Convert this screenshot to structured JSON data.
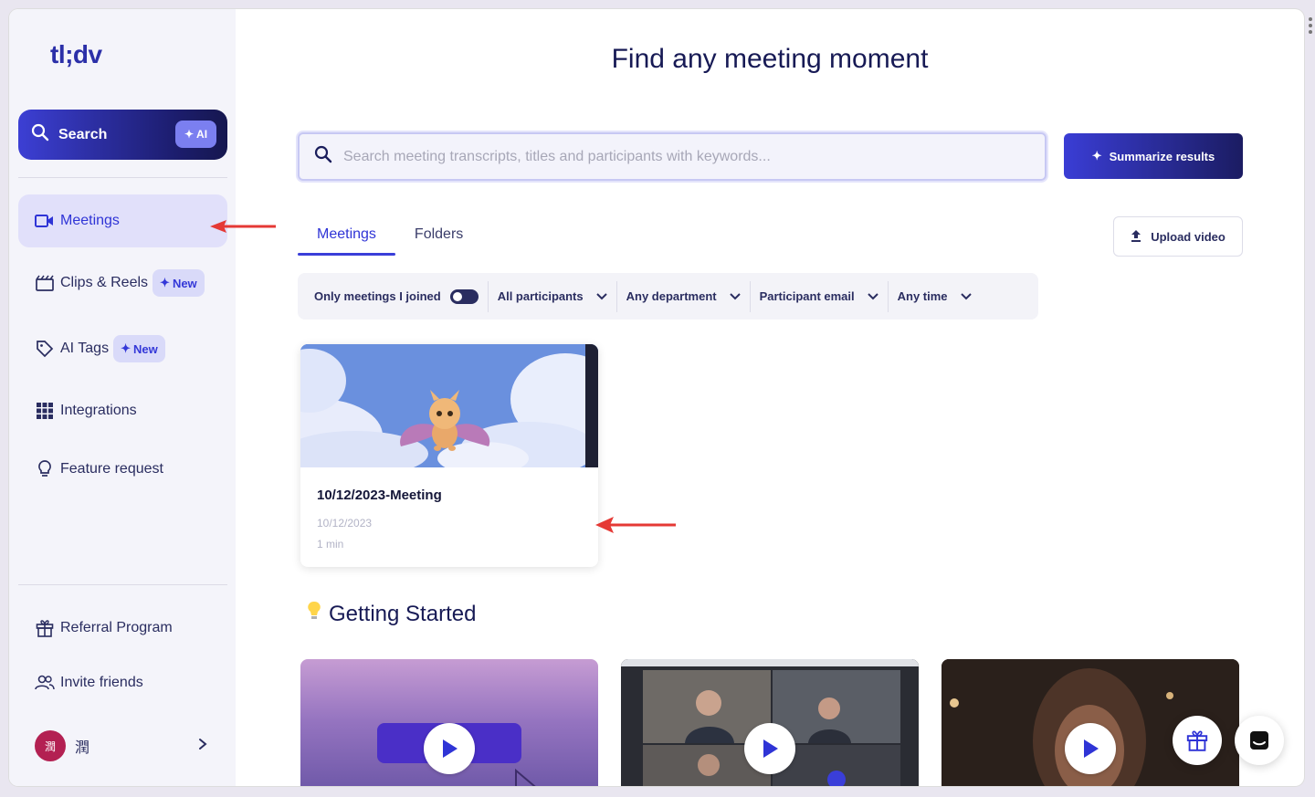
{
  "app": {
    "logo": "tl;dv"
  },
  "sidebar": {
    "search_label": "Search",
    "ai_badge": "AI",
    "items": [
      {
        "label": "Meetings",
        "icon": "video-camera-icon",
        "active": true
      },
      {
        "label": "Clips & Reels",
        "icon": "clapperboard-icon",
        "badge": "New"
      },
      {
        "label": "AI Tags",
        "icon": "tag-icon",
        "badge": "New"
      },
      {
        "label": "Integrations",
        "icon": "grid-icon"
      },
      {
        "label": "Feature request",
        "icon": "lightbulb-icon"
      }
    ],
    "bottom_items": [
      {
        "label": "Referral Program",
        "icon": "gift-icon"
      },
      {
        "label": "Invite friends",
        "icon": "users-icon"
      }
    ],
    "user": {
      "avatar_text": "潤",
      "name": "潤"
    }
  },
  "main": {
    "title": "Find any meeting moment",
    "search": {
      "placeholder": "Search meeting transcripts, titles and participants with keywords..."
    },
    "summarize_label": "Summarize results",
    "tabs": [
      {
        "label": "Meetings",
        "active": true
      },
      {
        "label": "Folders",
        "active": false
      }
    ],
    "upload_label": "Upload video",
    "filters": {
      "only_joined": "Only meetings I joined",
      "participants": "All participants",
      "department": "Any department",
      "email": "Participant email",
      "time": "Any time"
    },
    "meeting": {
      "title": "10/12/2023-Meeting",
      "date": "10/12/2023",
      "duration": "1 min"
    },
    "getting_started": "Getting Started"
  },
  "colors": {
    "accent": "#3a3ed9",
    "navy": "#1a1d5c",
    "annotation": "#e53935"
  }
}
